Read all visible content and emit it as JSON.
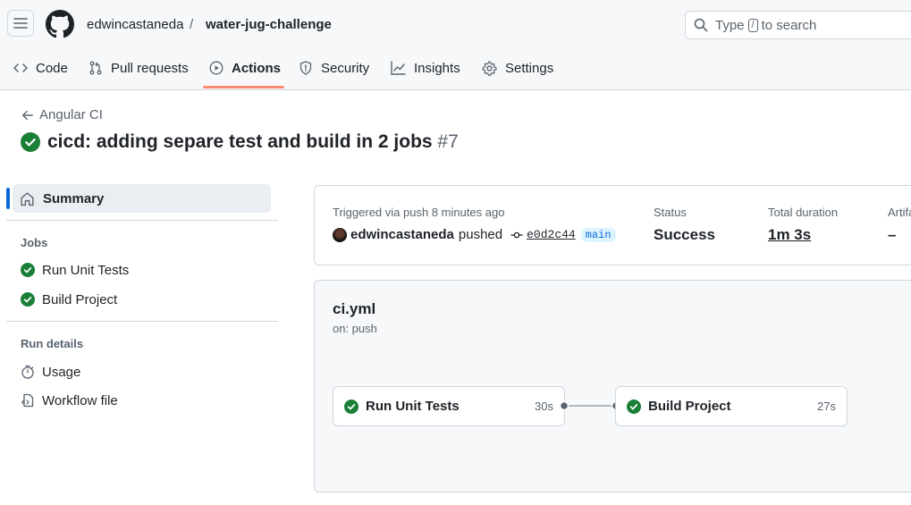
{
  "header": {
    "owner": "edwincastaneda",
    "separator": "/",
    "repo": "water-jug-challenge",
    "search": {
      "prefix": "Type",
      "key": "/",
      "suffix": "to search"
    }
  },
  "tabs": [
    {
      "label": "Code",
      "icon": "code-icon"
    },
    {
      "label": "Pull requests",
      "icon": "pull-request-icon"
    },
    {
      "label": "Actions",
      "icon": "play-icon",
      "selected": true
    },
    {
      "label": "Security",
      "icon": "shield-icon"
    },
    {
      "label": "Insights",
      "icon": "graph-icon"
    },
    {
      "label": "Settings",
      "icon": "gear-icon"
    }
  ],
  "run": {
    "workflow_link": "Angular CI",
    "title": "cicd: adding separe test and build in 2 jobs",
    "number": "#7"
  },
  "sidebar": {
    "summary": "Summary",
    "jobs_heading": "Jobs",
    "jobs": [
      "Run Unit Tests",
      "Build Project"
    ],
    "details_heading": "Run details",
    "details": [
      "Usage",
      "Workflow file"
    ]
  },
  "summary_card": {
    "trigger_text": "Triggered via push 8 minutes ago",
    "actor": "edwincastaneda",
    "action": "pushed",
    "commit": "e0d2c44",
    "branch": "main",
    "status_label": "Status",
    "status_value": "Success",
    "duration_label": "Total duration",
    "duration_value": "1m 3s",
    "artifacts_label": "Artifa",
    "artifacts_value": "–"
  },
  "graph": {
    "file": "ci.yml",
    "trigger": "on: push",
    "jobs": [
      {
        "name": "Run Unit Tests",
        "duration": "30s"
      },
      {
        "name": "Build Project",
        "duration": "27s"
      }
    ]
  },
  "colors": {
    "success": "#1a7f37",
    "accent": "#0969da",
    "tab_underline": "#fd8c73"
  }
}
